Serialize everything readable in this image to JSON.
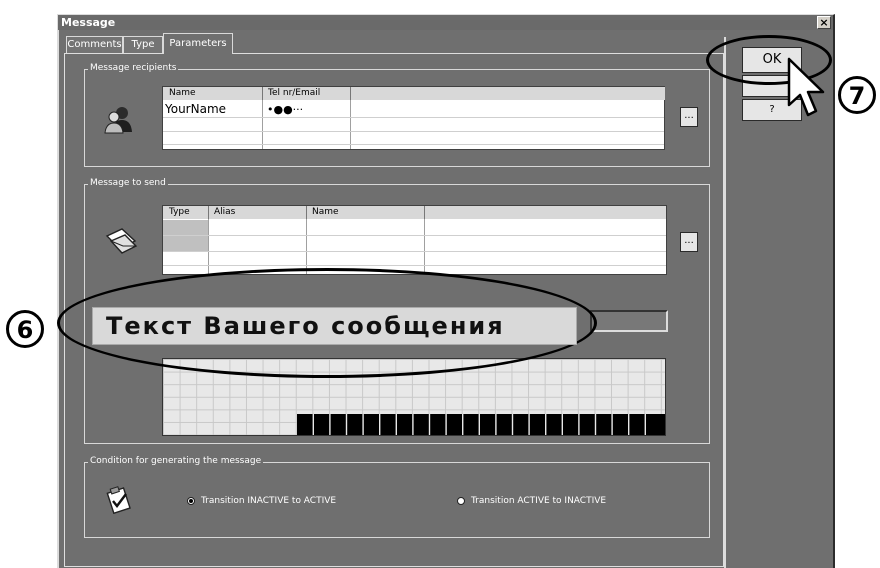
{
  "window": {
    "title": "Message",
    "close_glyph": "×"
  },
  "tabs": [
    {
      "label": "Comments"
    },
    {
      "label": "Type"
    },
    {
      "label": "Parameters",
      "active": true
    }
  ],
  "buttons": {
    "ok": "OK",
    "cancel": "",
    "help": "?",
    "dots": "..."
  },
  "recipients": {
    "label": "Message recipients",
    "columns": [
      "Name",
      "Tel nr/Email",
      ""
    ],
    "rows": [
      {
        "name": "YourName",
        "contact": "•●●···"
      }
    ]
  },
  "message": {
    "label": "Message to send",
    "columns": [
      "Type",
      "Alias",
      "Name",
      ""
    ]
  },
  "condition": {
    "label": "Condition for generating the message",
    "options": [
      {
        "label": "Transition INACTIVE to ACTIVE",
        "selected": true
      },
      {
        "label": "Transition ACTIVE to INACTIVE",
        "selected": false
      }
    ]
  },
  "annotations": {
    "message_text": "Текст Вашего сообщения",
    "marker_6": "6",
    "marker_7": "7"
  },
  "colors": {
    "window_bg": "#6f6f6f",
    "button_bg": "#e6e6e6",
    "text_on_dark": "#ffffff"
  }
}
